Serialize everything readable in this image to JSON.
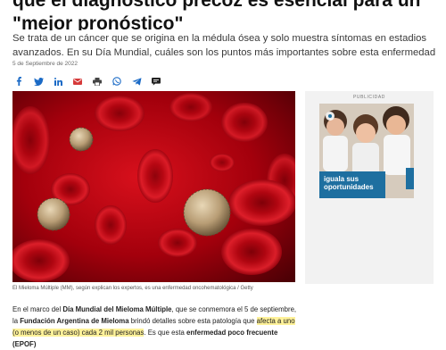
{
  "article": {
    "headline": "que el diagnóstico precoz es esencial para un \"mejor pronóstico\"",
    "subtitle": "Se trata de un cáncer que se origina en la médula ósea y solo muestra síntomas en estadios avanzados. En su Día Mundial, cuáles son los puntos más importantes sobre esta enfermedad",
    "date": "5 de Septiembre de 2022",
    "image_caption": "El Mieloma Múltiple (MM), según explican los expertos, es una enfermedad oncohematológica / Getty",
    "body": {
      "p1": "En el marco del ",
      "p2": "Día Mundial del Mieloma Múltiple",
      "p3": ", que se conmemora el 5 de septiembre, la ",
      "p4": "Fundación Argentina de Mieloma",
      "p5": " brindó detalles sobre esta patología que ",
      "p6": "afecta a uno (o menos de un caso) cada 2 mil personas",
      "p7": ". Es que esta ",
      "p8": "enfermedad poco frecuente (EPOF)"
    }
  },
  "share_icons": [
    "facebook-icon",
    "twitter-icon",
    "linkedin-icon",
    "email-icon",
    "print-icon",
    "whatsapp-icon",
    "telegram-icon",
    "comment-icon"
  ],
  "sidebar": {
    "ad_label": "PUBLICIDAD",
    "ad_text": "iguala sus oportunidades"
  },
  "colors": {
    "hero_red": "#b0000e",
    "ad_blue": "#1e6fa0",
    "share_blue": "#1a6ac6",
    "highlight": "#fff29a"
  }
}
